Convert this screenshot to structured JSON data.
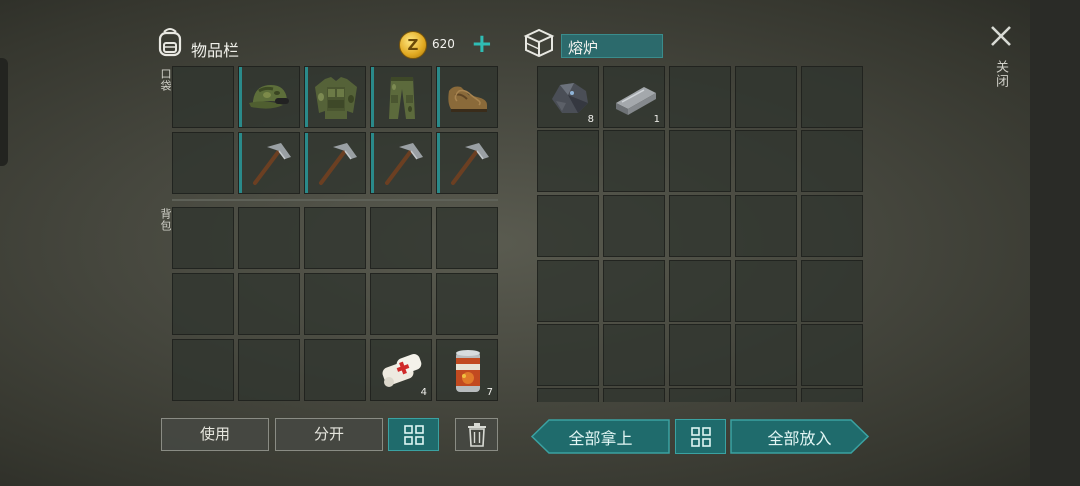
{
  "inventory": {
    "title": "物品栏",
    "coins": "620",
    "pocket_label": "口袋",
    "backpack_label": "背包"
  },
  "furnace": {
    "title": "熔炉"
  },
  "close": {
    "label": "关闭"
  },
  "slots": {
    "ore_count": "8",
    "ingot_count": "1",
    "bandage_count": "4",
    "canned_count": "7"
  },
  "buttons": {
    "use": "使用",
    "split": "分开",
    "take_all": "全部拿上",
    "put_all": "全部放入"
  },
  "icons": [
    "backpack-icon",
    "coin-icon",
    "plus-icon",
    "crate-icon",
    "close-icon",
    "cap-icon",
    "jacket-icon",
    "pants-icon",
    "boots-icon",
    "pickaxe-icon",
    "bandage-icon",
    "canned-food-icon",
    "stone-ore-icon",
    "iron-ingot-icon",
    "sort-grid-icon",
    "trash-icon"
  ],
  "colors": {
    "accent": "#2a8a8a",
    "coin": "#e0a820",
    "plus": "#2fbdb4",
    "teal_button": "#1f6b6c"
  }
}
